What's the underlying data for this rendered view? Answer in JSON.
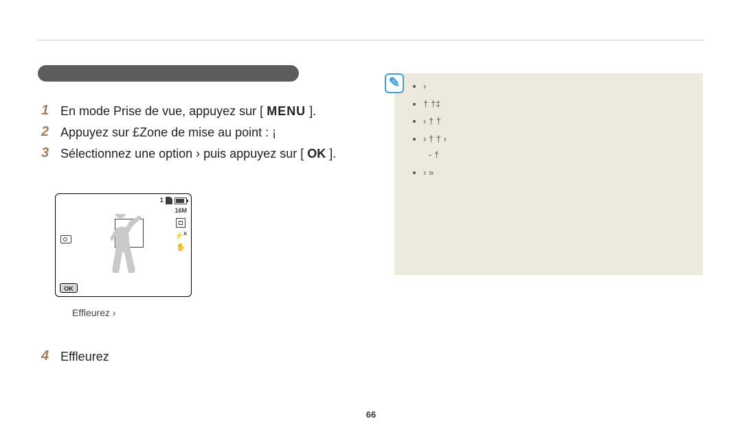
{
  "page_number": "66",
  "pill_label": "",
  "steps": {
    "one": {
      "num": "1",
      "pre": "En mode Prise de vue, appuyez sur [",
      "btn": "MENU",
      "post": "]."
    },
    "two": {
      "num": "2",
      "text": "Appuyez sur £Zone de mise au point : ¡"
    },
    "three": {
      "num": "3",
      "pre": "Sélectionnez une option › puis appuyez sur [",
      "btn": "OK",
      "post": "]."
    },
    "four": {
      "num": "4",
      "text": "Effleurez"
    }
  },
  "camera": {
    "counter": "1",
    "size": "16M",
    "flash_suffix": "A",
    "ok_label": "OK"
  },
  "under_shot": "Effleurez ›",
  "note": {
    "bullets": [
      "›",
      "† †‡",
      "› † †",
      "› † † ›",
      "†",
      "› »"
    ]
  }
}
